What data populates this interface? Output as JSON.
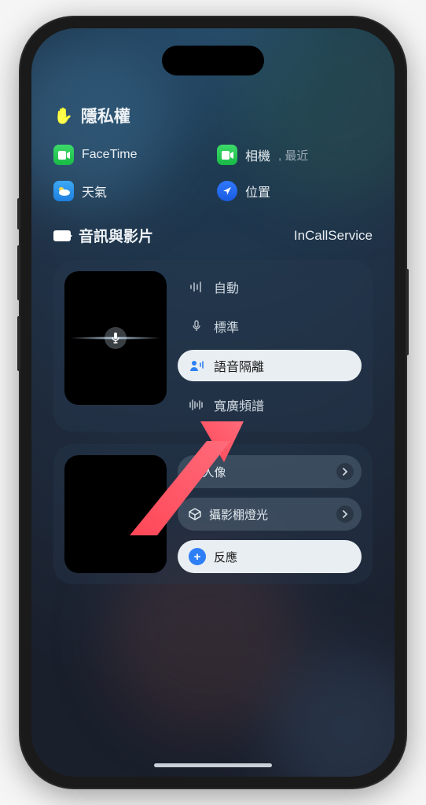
{
  "privacy": {
    "title": "隱私權"
  },
  "apps": {
    "facetime": {
      "label": "FaceTime"
    },
    "camera": {
      "label": "相機",
      "sublabel": ", 最近"
    },
    "weather": {
      "label": "天氣"
    },
    "location": {
      "label": "位置"
    }
  },
  "section": {
    "title": "音訊與影片",
    "service": "InCallService"
  },
  "micModes": {
    "auto": "自動",
    "standard": "標準",
    "voiceIsolation": "語音隔離",
    "wideSpectrum": "寬廣頻譜"
  },
  "videoEffects": {
    "portrait": "人像",
    "studioLight": "攝影棚燈光",
    "reactions": "反應"
  }
}
